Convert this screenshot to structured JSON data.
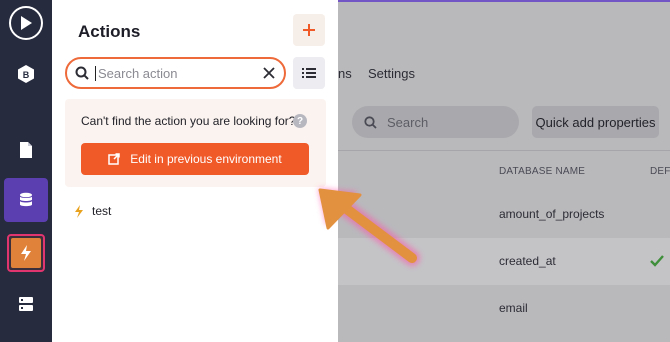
{
  "panel": {
    "title": "Actions",
    "search_placeholder": "Search action",
    "notice_text": "Can't find the action you are looking for?",
    "edit_button_label": "Edit in previous environment",
    "actions": [
      {
        "label": "test"
      }
    ]
  },
  "background": {
    "tab_partial": "ns",
    "tab_settings": "Settings",
    "search_placeholder": "Search",
    "quick_add_label": "Quick add properties",
    "columns": [
      "DATABASE NAME",
      "DEFA"
    ],
    "rows": [
      {
        "database_name": "amount_of_projects",
        "default_checked": false
      },
      {
        "database_name": "created_at",
        "default_checked": true
      },
      {
        "database_name": "email",
        "default_checked": false
      }
    ]
  },
  "colors": {
    "accent": "#f05a28",
    "sidebar": "#262b3e",
    "active_nav": "#5b3fb0",
    "check": "#3e8e3a"
  },
  "icons": [
    "play-icon",
    "logo-icon",
    "page-icon",
    "database-icon",
    "lightning-icon",
    "server-icon",
    "plus-icon",
    "search-icon",
    "clear-icon",
    "list-icon",
    "help-icon",
    "external-link-icon",
    "check-icon",
    "arrow-annotation"
  ]
}
